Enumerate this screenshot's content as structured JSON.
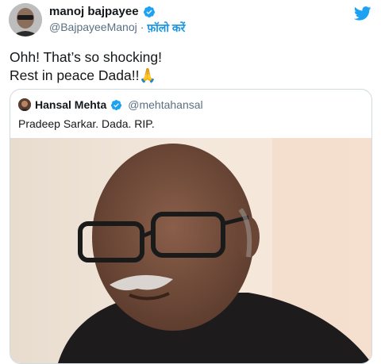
{
  "tweet": {
    "author": {
      "display_name": "manoj bajpayee",
      "handle": "@BajpayeeManoj",
      "separator": "·",
      "follow_label": "फ़ॉलो करें",
      "verified": true,
      "avatar_icon": "user-avatar"
    },
    "text": "Ohh! That’s so shocking!\nRest in peace Dada!!🙏",
    "brand_icon": "twitter-bird-icon",
    "brand_color": "#1da1f2",
    "quoted": {
      "display_name": "Hansal Mehta",
      "handle": "@mehtahansal",
      "verified": true,
      "text": "Pradeep Sarkar. Dada. RIP.",
      "media_icon": "photo-portrait"
    }
  },
  "colors": {
    "verified": "#1da1f2",
    "link": "#1b95e0",
    "muted": "#5b7083",
    "border": "#cfd9de"
  }
}
